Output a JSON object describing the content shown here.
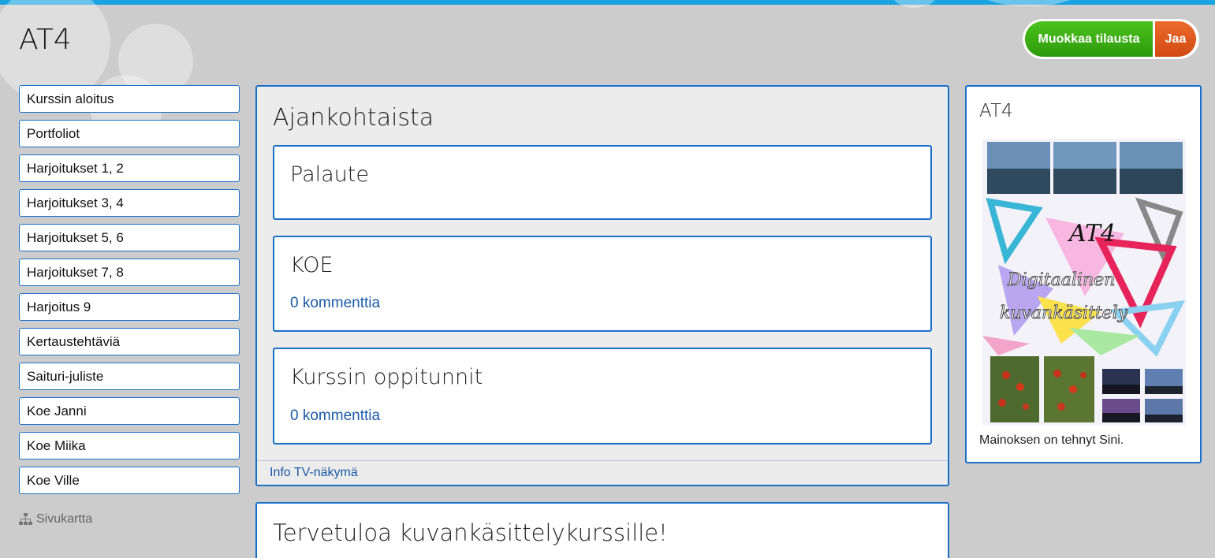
{
  "header": {
    "site_title": "AT4",
    "edit_button": "Muokkaa tilausta",
    "share_button": "Jaa"
  },
  "nav": {
    "items": [
      "Kurssin aloitus",
      "Portfoliot",
      "Harjoitukset 1, 2",
      "Harjoitukset 3, 4",
      "Harjoitukset 5, 6",
      "Harjoitukset 7, 8",
      "Harjoitus 9",
      "Kertaustehtäviä",
      "Saituri-juliste",
      "Koe Janni",
      "Koe Miika",
      "Koe Ville"
    ],
    "sitemap_label": "Sivukartta",
    "sitemap_icon": "sitemap-icon"
  },
  "main": {
    "title": "Ajankohtaista",
    "cards": [
      {
        "title": "Palaute",
        "link": ""
      },
      {
        "title": "KOE",
        "link": "0 kommenttia"
      },
      {
        "title": "Kurssin oppitunnit",
        "link": "0 kommenttia"
      }
    ],
    "footer_link": "Info TV-näkymä"
  },
  "welcome": {
    "title": "Tervetuloa kuvankäsittelykurssille!"
  },
  "side": {
    "title": "AT4",
    "poster_text": [
      "AT4",
      "Digitaalinen",
      "kuvankäsittely"
    ],
    "caption": "Mainoksen on tehnyt Sini."
  },
  "colors": {
    "background": "#cccccc",
    "accent_blue": "#1a6fc9",
    "top_bar": "#1aa3e0",
    "edit_green": "#34a612",
    "share_orange": "#e05a1e",
    "link": "#1c5aa8"
  }
}
